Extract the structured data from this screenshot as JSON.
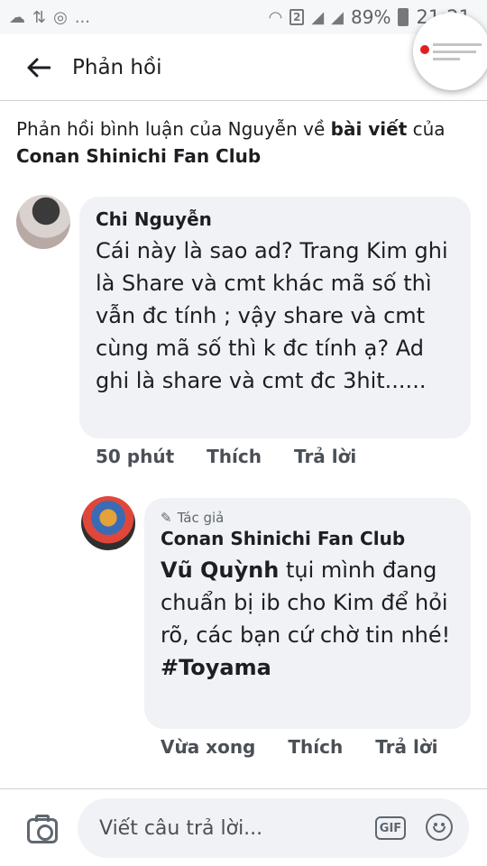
{
  "status_bar": {
    "icons": [
      "cloud-icon",
      "data-transfer-icon",
      "media-icon",
      "wifi-icon",
      "sim-2-icon",
      "signal-icon",
      "signal-icon",
      "battery-icon"
    ],
    "more": "...",
    "sim_label": "2",
    "battery_percent": "89%",
    "time": "21:21"
  },
  "header": {
    "title": "Phản hồi"
  },
  "context": {
    "prefix": "Phản hồi bình luận của Nguyễn về ",
    "link": "bài viết",
    "middle": " của",
    "page_name": "Conan Shinichi Fan Club"
  },
  "comment": {
    "author": "Chi Nguyễn",
    "text": "Cái này là sao ad? Trang Kim ghi là Share và cmt khác mã số thì vẫn đc tính ; vậy share và cmt cùng mã số thì k đc tính ạ? Ad ghi là share và cmt đc 3hit......",
    "time": "50 phút",
    "like_label": "Thích",
    "reply_label": "Trả lời"
  },
  "reply": {
    "badge": "Tác giả",
    "author": "Conan Shinichi Fan Club",
    "mention": "Vũ Quỳnh",
    "text": " tụi mình đang chuẩn bị ib cho Kim để hỏi rõ, các bạn cứ chờ tin nhé!",
    "hashtag": "#Toyama",
    "time": "Vừa xong",
    "like_label": "Thích",
    "reply_label": "Trả lời"
  },
  "composer": {
    "placeholder": "Viết câu trả lời...",
    "gif_label": "GIF"
  }
}
